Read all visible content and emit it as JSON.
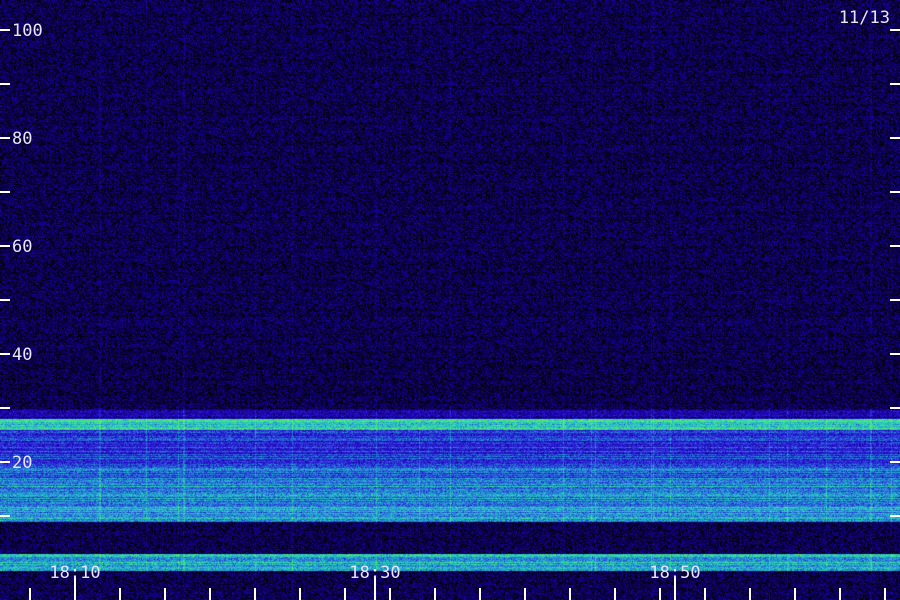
{
  "chart_data": {
    "type": "heatmap",
    "title": "",
    "xlabel": "",
    "ylabel": "",
    "date_label": "11/13",
    "y_axis": {
      "range": [
        0,
        100
      ],
      "tick_labels": [
        {
          "value": 20,
          "label": "20"
        },
        {
          "value": 40,
          "label": "40"
        },
        {
          "value": 60,
          "label": "60"
        },
        {
          "value": 80,
          "label": "80"
        },
        {
          "value": 100,
          "label": "100"
        }
      ],
      "minor_tick_values": [
        10,
        30,
        50,
        70,
        90
      ]
    },
    "x_axis": {
      "range": [
        "18:05",
        "19:05"
      ],
      "tick_labels": [
        {
          "value": "18:10",
          "label": "18:10"
        },
        {
          "value": "18:30",
          "label": "18:30"
        },
        {
          "value": "18:50",
          "label": "18:50"
        }
      ],
      "tick_values": [
        "18:07",
        "18:10",
        "18:13",
        "18:16",
        "18:19",
        "18:22",
        "18:25",
        "18:28",
        "18:31",
        "18:34",
        "18:37",
        "18:40",
        "18:43",
        "18:46",
        "18:49",
        "18:52",
        "18:55",
        "18:58",
        "19:01",
        "19:04"
      ]
    },
    "colormap": [
      "#000000",
      "#14008c",
      "#2a10d8",
      "#2a6ad8",
      "#20c8c8",
      "#60f060"
    ],
    "bands": [
      {
        "y_range": [
          0,
          3
        ],
        "intensity": 0.75
      },
      {
        "y_range": [
          9,
          16
        ],
        "intensity": 0.7
      },
      {
        "y_range": [
          16,
          19
        ],
        "intensity": 0.6
      },
      {
        "y_range": [
          19,
          23
        ],
        "intensity": 0.5
      },
      {
        "y_range": [
          23,
          26
        ],
        "intensity": 0.45
      },
      {
        "y_range": [
          26,
          28
        ],
        "intensity": 0.85
      },
      {
        "y_range": [
          28,
          30
        ],
        "intensity": 0.3
      },
      {
        "y_range": [
          30,
          100
        ],
        "intensity": 0.12
      }
    ]
  }
}
